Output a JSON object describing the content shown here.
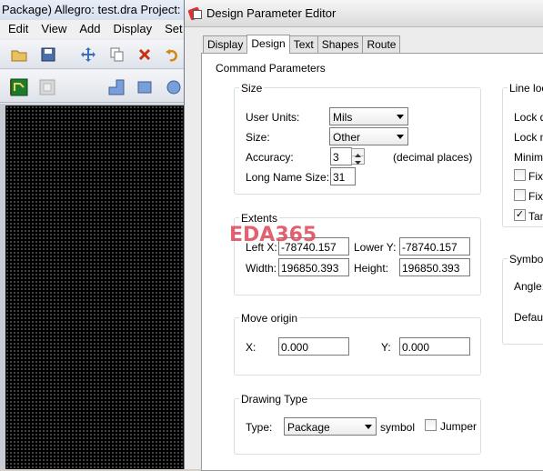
{
  "app": {
    "title": "Package) Allegro: test.dra  Project:",
    "menu": [
      "Edit",
      "View",
      "Add",
      "Display",
      "Set"
    ]
  },
  "dialog": {
    "title": "Design Parameter Editor",
    "tabs": [
      "Display",
      "Design",
      "Text",
      "Shapes",
      "Route"
    ],
    "active_tab": "Design",
    "command_parameters": "Command Parameters",
    "size": {
      "title": "Size",
      "user_units_label": "User Units:",
      "user_units": "Mils",
      "size_label": "Size:",
      "size": "Other",
      "accuracy_label": "Accuracy:",
      "accuracy": "3",
      "accuracy_note": "(decimal places)",
      "long_name_label": "Long Name Size:",
      "long_name": "31"
    },
    "extents": {
      "title": "Extents",
      "left_x_label": "Left X:",
      "left_x": "-78740.157",
      "lower_y_label": "Lower Y:",
      "lower_y": "-78740.157",
      "width_label": "Width:",
      "width": "196850.393",
      "height_label": "Height:",
      "height": "196850.393"
    },
    "move_origin": {
      "title": "Move origin",
      "x_label": "X:",
      "x": "0.000",
      "y_label": "Y:",
      "y": "0.000"
    },
    "drawing_type": {
      "title": "Drawing Type",
      "type_label": "Type:",
      "type": "Package",
      "symbol_label": "symbol",
      "jumper_label": "Jumper",
      "jumper_checked": false
    },
    "line_lock": {
      "title": "Line lock",
      "lock_d": "Lock d",
      "lock_m": "Lock m",
      "minimum": "Minimu",
      "fixed1": "Fixe",
      "fixed2": "Fixe",
      "tangent": "Tan",
      "tangent_checked": true
    },
    "symbol": {
      "title": "Symbol",
      "angle_label": "Angle:",
      "default_label": "Default"
    }
  },
  "watermark": "EDA365"
}
